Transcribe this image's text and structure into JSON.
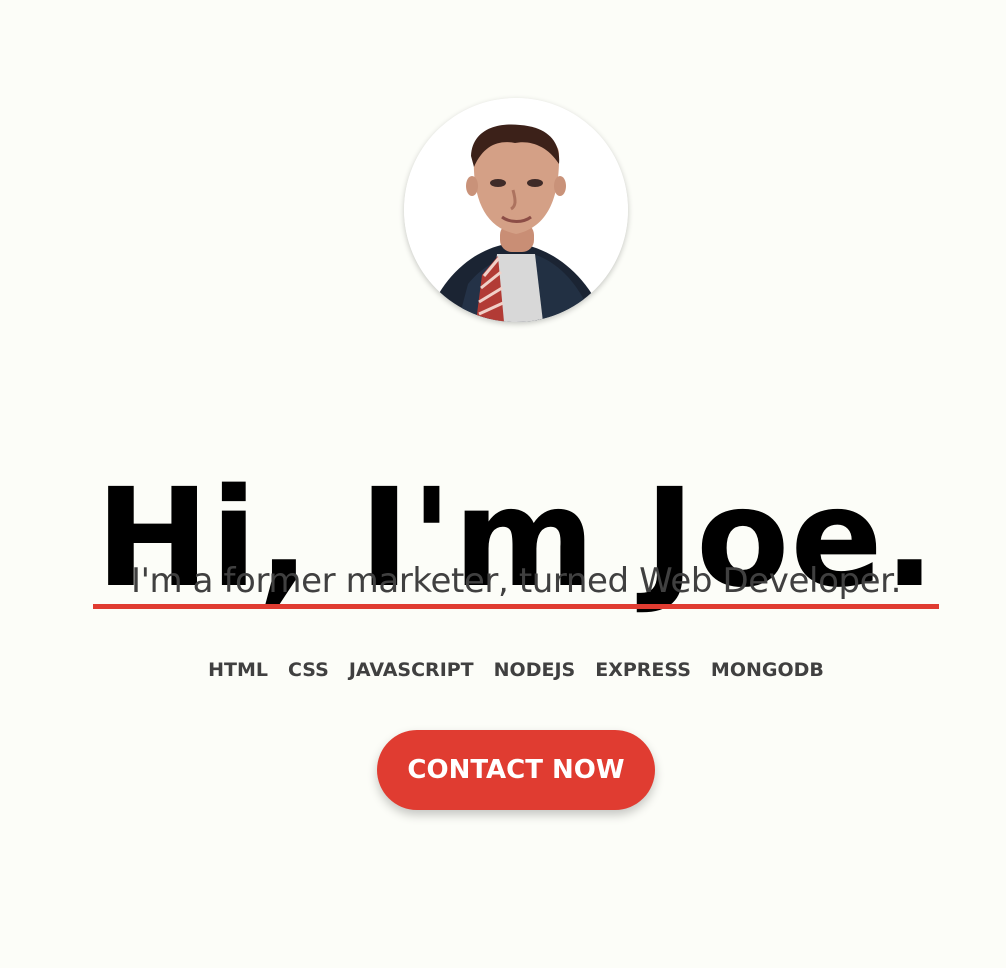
{
  "hero": {
    "heading": "Hi, I'm Joe.",
    "subheading": "I'm a former marketer, turned Web Developer."
  },
  "skills": [
    "HTML",
    "CSS",
    "JAVASCRIPT",
    "NODEJS",
    "EXPRESS",
    "MONGODB"
  ],
  "contact_button_label": "CONTACT NOW",
  "colors": {
    "accent": "#e03c31",
    "background": "#fcfdf8",
    "text_dark": "#000000",
    "text_muted": "#404040"
  }
}
